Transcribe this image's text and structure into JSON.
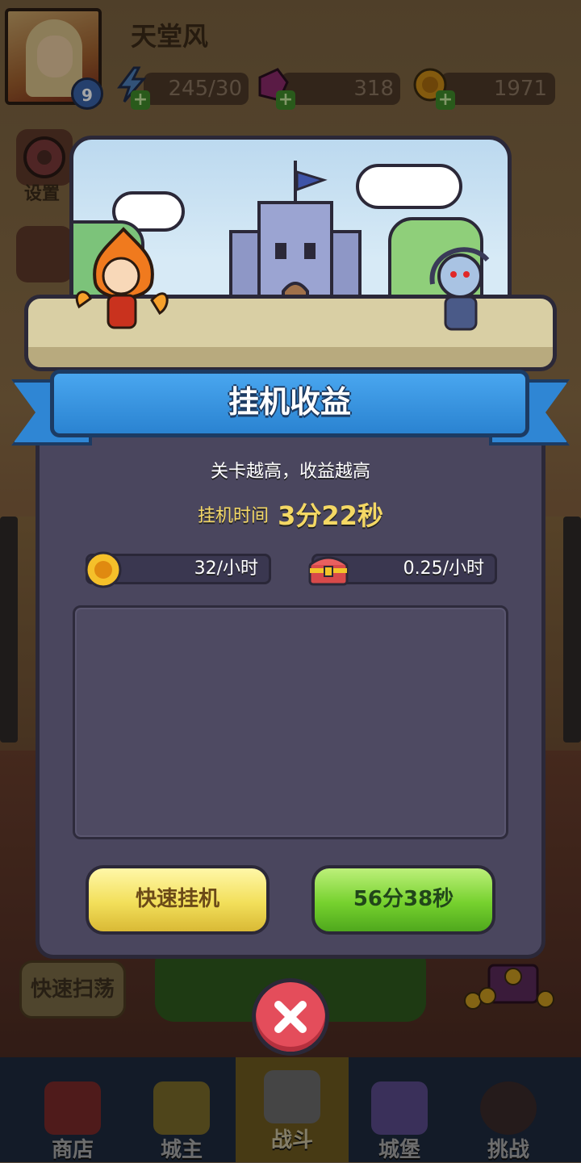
{
  "player": {
    "name": "天堂风",
    "level": "9"
  },
  "resources": {
    "energy": "245/30",
    "gems": "318",
    "gold": "1971"
  },
  "side_menu": {
    "settings_label": "设置"
  },
  "background": {
    "quick_sweep_label": "快速扫荡"
  },
  "modal": {
    "title": "挂机收益",
    "subtitle": "关卡越高，收益越高",
    "time_label": "挂机时间",
    "time_value": "3分22秒",
    "gold_rate": "32/小时",
    "chest_rate": "0.25/小时",
    "quick_idle_label": "快速挂机",
    "countdown_label": "56分38秒"
  },
  "nav": {
    "items": [
      {
        "label": "商店"
      },
      {
        "label": "城主"
      },
      {
        "label": "战斗"
      },
      {
        "label": "城堡"
      },
      {
        "label": "挑战"
      }
    ],
    "active_index": 2
  },
  "colors": {
    "ribbon": "#2a83d1",
    "modal_body": "#4a465e",
    "accent_yellow": "#f4d864",
    "close_red": "#e44d5b"
  }
}
